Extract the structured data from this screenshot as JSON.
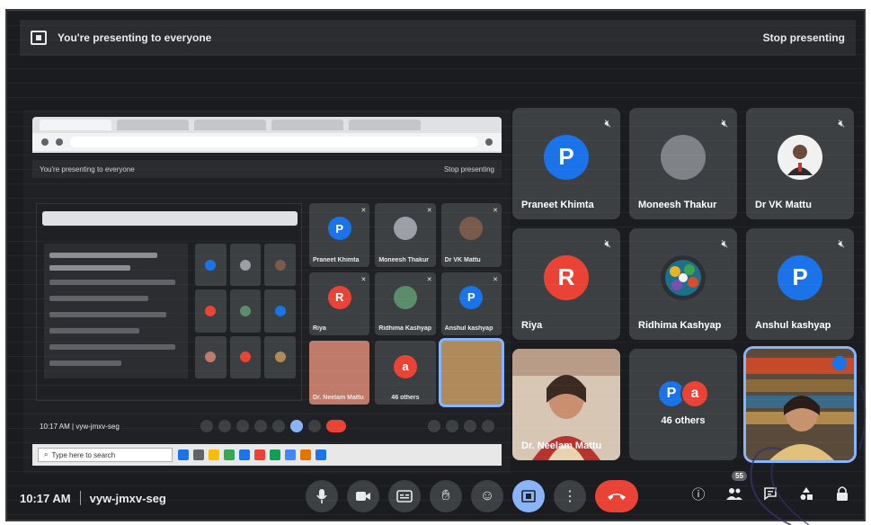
{
  "banner": {
    "text": "You're presenting to everyone",
    "stop_label": "Stop presenting"
  },
  "shared_screen": {
    "nested_banner_text": "You're presenting to everyone",
    "nested_stop_label": "Stop presenting",
    "nested_tiles": [
      {
        "name": "Praneet Khimta",
        "initial": "P",
        "color": "#1a73e8"
      },
      {
        "name": "Moneesh Thakur",
        "initial": "",
        "color": "#9aa0a6"
      },
      {
        "name": "Dr VK Mattu",
        "initial": "",
        "color": "#7a5a4a"
      },
      {
        "name": "Riya",
        "initial": "R",
        "color": "#ea4335"
      },
      {
        "name": "Ridhima Kashyap",
        "initial": "",
        "color": "#5b8c6b"
      },
      {
        "name": "Anshul kashyap",
        "initial": "P",
        "color": "#1a73e8"
      },
      {
        "name": "Dr. Neelam Mattu",
        "initial": "",
        "color": "#c07a6a"
      },
      {
        "name": "46 others",
        "initial": "a",
        "color": "#ea4335"
      },
      {
        "name": "",
        "initial": "",
        "color": "#b08a5a"
      }
    ],
    "nested_time": "10:17 AM",
    "nested_code": "vyw-jmxv-seg",
    "taskbar_search": "Type here to search"
  },
  "tiles": [
    {
      "name": "Praneet Khimta",
      "initial": "P",
      "color": "#1a73e8",
      "kind": "initial"
    },
    {
      "name": "Moneesh Thakur",
      "initial": "",
      "color": "#7f8388",
      "kind": "photo-gray"
    },
    {
      "name": "Dr VK Mattu",
      "initial": "",
      "color": "#8a5a42",
      "kind": "photo"
    },
    {
      "name": "Riya",
      "initial": "R",
      "color": "#ea4335",
      "kind": "initial"
    },
    {
      "name": "Ridhima Kashyap",
      "initial": "",
      "color": "#4a8a5a",
      "kind": "photo"
    },
    {
      "name": "Anshul kashyap",
      "initial": "P",
      "color": "#1a73e8",
      "kind": "initial"
    },
    {
      "name": "Dr. Neelam Mattu",
      "initial": "",
      "color": "#c48a7a",
      "kind": "video"
    },
    {
      "name": "46 others",
      "initial": "",
      "color": "",
      "kind": "others",
      "others_initials": [
        "P",
        "a"
      ]
    },
    {
      "name": "",
      "initial": "",
      "color": "#9a7a4a",
      "kind": "video-self"
    }
  ],
  "bottom": {
    "time": "10:17 AM",
    "meeting_code": "vyw-jmxv-seg",
    "people_count": "55"
  },
  "icons": {
    "mic": "mic-icon",
    "camera": "camera-icon",
    "captions": "captions-icon",
    "hand": "raise-hand-icon",
    "emoji": "emoji-icon",
    "present": "present-icon",
    "more": "more-vert-icon",
    "end": "end-call-icon",
    "info": "info-icon",
    "people": "people-icon",
    "chat": "chat-icon",
    "activities": "activities-icon",
    "lock": "host-controls-icon"
  },
  "colors": {
    "accent": "#8ab4f8",
    "end_call": "#ea4335",
    "tile_bg": "#3c4043"
  }
}
